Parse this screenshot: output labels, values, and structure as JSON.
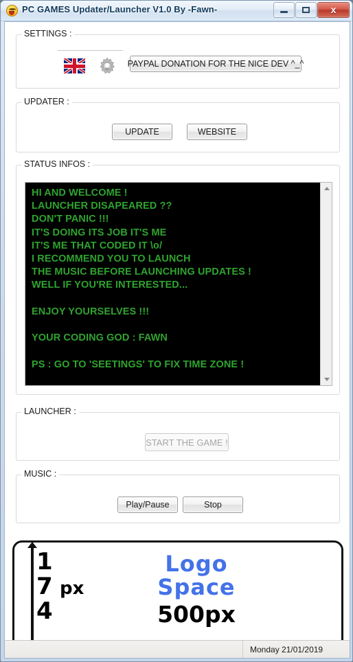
{
  "window": {
    "title": "PC GAMES Updater/Launcher V1.0 By -Fawn-",
    "app_icon": "smiley-icon",
    "minimize_label": "",
    "maximize_label": "",
    "close_label": "x"
  },
  "settings": {
    "group_label": "SETTINGS :",
    "flag_icon": "uk-flag-icon",
    "gear_icon": "gear-icon",
    "paypal_button": "PAYPAL DONATION FOR THE NICE DEV ^_^"
  },
  "updater": {
    "group_label": "UPDATER :",
    "update_button": "UPDATE",
    "website_button": "WEBSITE"
  },
  "status_infos": {
    "group_label": "STATUS INFOS :",
    "text": "HI AND WELCOME !\nLAUNCHER DISAPEARED ??\nDON'T PANIC !!!\nIT'S DOING ITS JOB IT'S ME\nIT'S ME THAT CODED IT \\o/\nI RECOMMEND YOU TO LAUNCH\nTHE MUSIC BEFORE LAUNCHING UPDATES !\nWELL IF YOU'RE INTERESTED...\n\nENJOY YOURSELVES !!!\n\nYOUR CODING GOD : FAWN\n\nPS : GO TO 'SEETINGS' TO FIX TIME ZONE !",
    "text_color": "#2fa32f",
    "background_color": "#000000",
    "scroll_up_icon": "scroll-up-arrow-icon",
    "scroll_down_icon": "scroll-down-arrow-icon"
  },
  "launcher": {
    "group_label": "LAUNCHER :",
    "start_button": "START THE GAME !",
    "start_button_enabled": false
  },
  "music": {
    "group_label": "MUSIC :",
    "play_pause_button": "Play/Pause",
    "stop_button": "Stop"
  },
  "logo_space": {
    "height_label": "174",
    "height_unit": "px",
    "line1": "Logo",
    "line2": "Space",
    "width_label": "500px",
    "logo_color": "#4472e8"
  },
  "statusbar": {
    "date": "Monday 21/01/2019"
  }
}
